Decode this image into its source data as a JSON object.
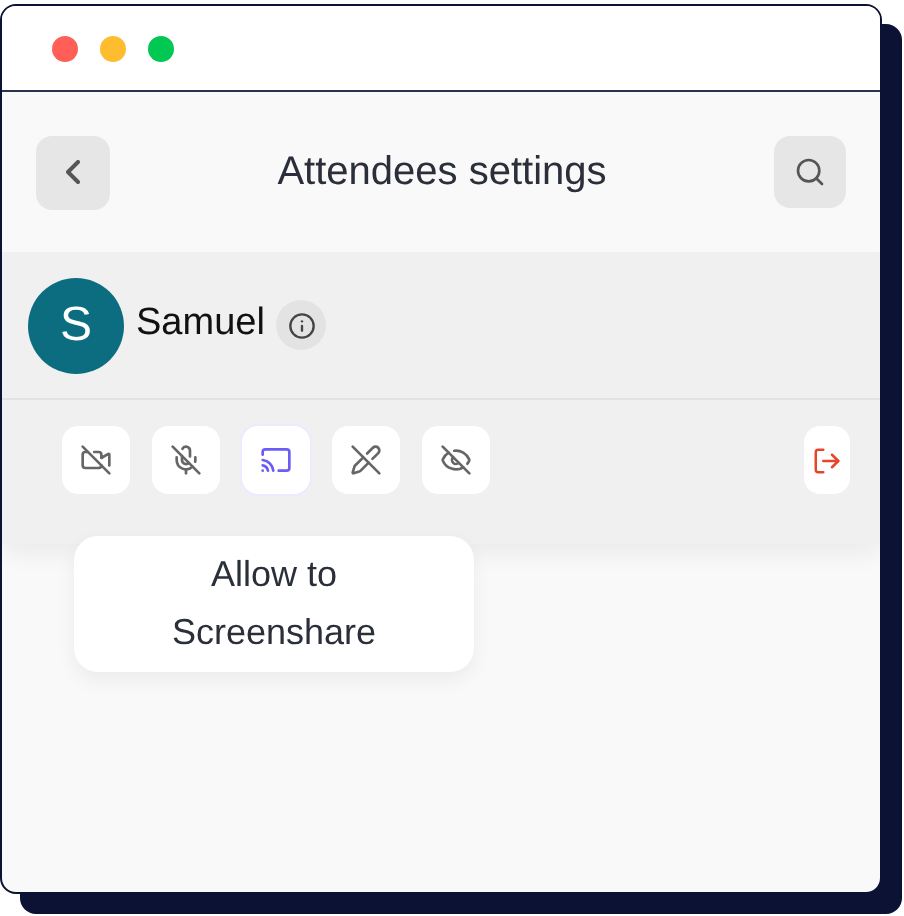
{
  "window": {
    "title": "Attendees settings"
  },
  "attendee": {
    "initial": "S",
    "name": "Samuel"
  },
  "controls": [
    {
      "kind": "camera",
      "selected": false
    },
    {
      "kind": "mic",
      "selected": false
    },
    {
      "kind": "screenshare",
      "selected": true
    },
    {
      "kind": "draw",
      "selected": false
    },
    {
      "kind": "visibility",
      "selected": false
    }
  ],
  "tooltip": "Allow to Screenshare"
}
